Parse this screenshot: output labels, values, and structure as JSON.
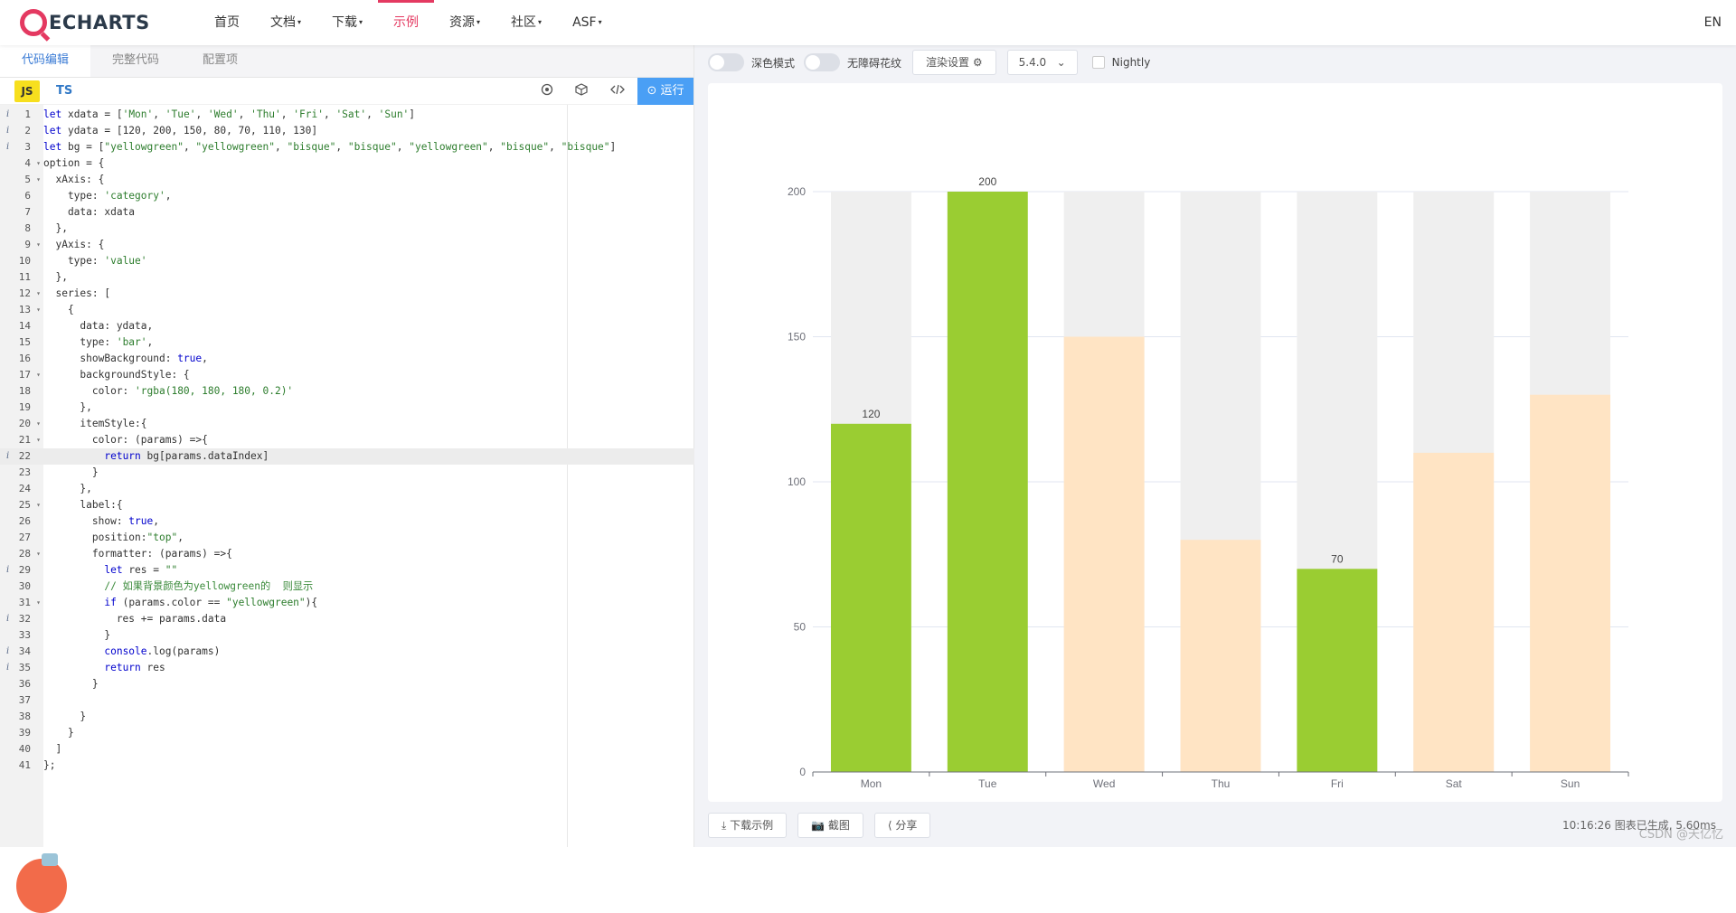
{
  "nav": {
    "logo_text": "ECHARTS",
    "items": [
      {
        "label": "首页",
        "caret": ""
      },
      {
        "label": "文档",
        "caret": "▾"
      },
      {
        "label": "下载",
        "caret": "▾"
      },
      {
        "label": "示例",
        "caret": ""
      },
      {
        "label": "资源",
        "caret": "▾"
      },
      {
        "label": "社区",
        "caret": "▾"
      },
      {
        "label": "ASF",
        "caret": "▾"
      }
    ],
    "active": "示例",
    "lang": "EN"
  },
  "editor": {
    "tabs": [
      "代码编辑",
      "完整代码",
      "配置项"
    ],
    "active_tab": "代码编辑",
    "js_label": "JS",
    "ts_label": "TS",
    "run_label": "运行",
    "highlighted_line": 22,
    "info_lines": [
      1,
      2,
      3,
      22,
      29,
      32,
      34,
      35
    ],
    "fold_lines": [
      4,
      5,
      9,
      12,
      13,
      17,
      20,
      21,
      25,
      28,
      31
    ],
    "lines": [
      "let xdata = ['Mon', 'Tue', 'Wed', 'Thu', 'Fri', 'Sat', 'Sun']",
      "let ydata = [120, 200, 150, 80, 70, 110, 130]",
      "let bg = [\"yellowgreen\", \"yellowgreen\", \"bisque\", \"bisque\", \"yellowgreen\", \"bisque\", \"bisque\"]",
      "option = {",
      "  xAxis: {",
      "    type: 'category',",
      "    data: xdata",
      "  },",
      "  yAxis: {",
      "    type: 'value'",
      "  },",
      "  series: [",
      "    {",
      "      data: ydata,",
      "      type: 'bar',",
      "      showBackground: true,",
      "      backgroundStyle: {",
      "        color: 'rgba(180, 180, 180, 0.2)'",
      "      },",
      "      itemStyle:{",
      "        color: (params) =>{",
      "          return bg[params.dataIndex]",
      "        }",
      "      },",
      "      label:{",
      "        show: true,",
      "        position:\"top\",",
      "        formatter: (params) =>{",
      "          let res = \"\"",
      "          // 如果背景颜色为yellowgreen的  则显示",
      "          if (params.color == \"yellowgreen\"){",
      "            res += params.data",
      "          }",
      "          console.log(params)",
      "          return res",
      "        }",
      "",
      "      }",
      "    }",
      "  ]",
      "};"
    ]
  },
  "preview": {
    "dark_mode_label": "深色模式",
    "aria_label": "无障碍花纹",
    "render_label": "渲染设置",
    "version": "5.4.0",
    "nightly_label": "Nightly",
    "download_label": "下载示例",
    "screenshot_label": "截图",
    "share_label": "分享",
    "status_text": "10:16:26  图表已生成, 5.60ms",
    "watermark": "CSDN @天亿忆"
  },
  "chart_data": {
    "type": "bar",
    "categories": [
      "Mon",
      "Tue",
      "Wed",
      "Thu",
      "Fri",
      "Sat",
      "Sun"
    ],
    "values": [
      120,
      200,
      150,
      80,
      70,
      110,
      130
    ],
    "bar_colors": [
      "yellowgreen",
      "yellowgreen",
      "bisque",
      "bisque",
      "yellowgreen",
      "bisque",
      "bisque"
    ],
    "bar_color_hex": {
      "yellowgreen": "#9acd32",
      "bisque": "#ffe4c4"
    },
    "background_bar_color": "#efefef",
    "labels_shown": [
      "120",
      "200",
      "",
      "",
      "70",
      "",
      ""
    ],
    "ylim": [
      0,
      200
    ],
    "yticks": [
      0,
      50,
      100,
      150,
      200
    ],
    "grid": true,
    "title": "",
    "xlabel": "",
    "ylabel": ""
  }
}
